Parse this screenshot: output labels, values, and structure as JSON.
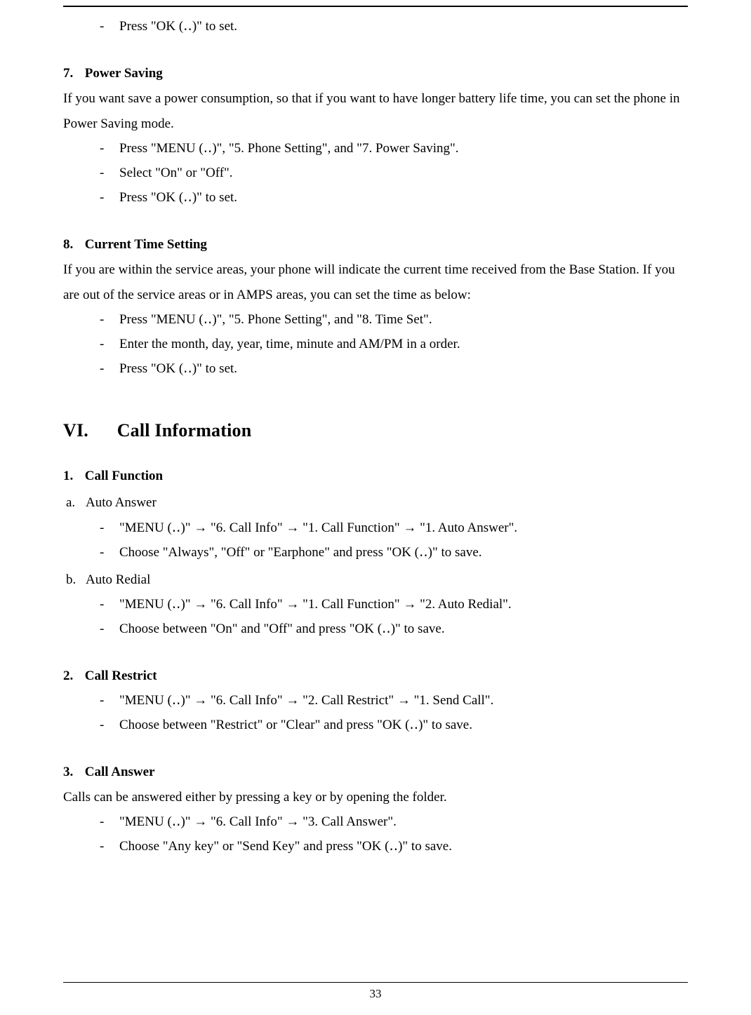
{
  "intro_bullet": "Press \"OK (‥)\" to set.",
  "sec7": {
    "heading_num": "7.",
    "heading_text": "Power Saving",
    "para": "If you want save a power consumption, so that if you want to have longer battery life time, you can set the phone in Power Saving mode.",
    "bullets": [
      "Press \"MENU (‥)\", \"5. Phone Setting\", and \"7. Power Saving\".",
      "Select \"On\" or \"Off\".",
      "Press \"OK (‥)\" to set."
    ]
  },
  "sec8": {
    "heading_num": "8.",
    "heading_text": "Current Time Setting",
    "para": "If you are within the service areas, your phone will indicate the current time received from the Base Station. If you are out of the service areas or in AMPS areas, you can set the time as below:",
    "bullets": [
      "Press \"MENU (‥)\", \"5. Phone Setting\", and \"8. Time Set\".",
      "Enter the month, day, year, time, minute and AM/PM in a order.",
      "Press \"OK (‥)\" to set."
    ]
  },
  "chapter": {
    "roman": "VI.",
    "title": "Call Information"
  },
  "sec1": {
    "heading_num": "1.",
    "heading_text": "Call Function",
    "a_label": "a.",
    "a_text": "Auto Answer",
    "a_bullets": [
      "\"MENU (‥)\" → \"6. Call Info\" → \"1. Call Function\" → \"1. Auto Answer\".",
      "Choose \"Always\", \"Off\" or \"Earphone\" and press \"OK (‥)\" to save."
    ],
    "b_label": "b.",
    "b_text": "Auto Redial",
    "b_bullets": [
      "\"MENU (‥)\" → \"6. Call Info\" → \"1. Call Function\" → \"2. Auto Redial\".",
      "Choose between \"On\" and \"Off\" and press \"OK (‥)\" to save."
    ]
  },
  "sec2": {
    "heading_num": "2.",
    "heading_text": "Call Restrict",
    "bullets": [
      "\"MENU (‥)\" → \"6. Call Info\" → \"2. Call Restrict\" → \"1. Send Call\".",
      "Choose between \"Restrict\" or \"Clear\" and press \"OK (‥)\" to save."
    ]
  },
  "sec3": {
    "heading_num": "3.",
    "heading_text": "Call Answer",
    "para": "Calls can be answered either by pressing a key or by opening the folder.",
    "bullets": [
      "\"MENU (‥)\" → \"6. Call Info\" → \"3. Call Answer\".",
      "Choose \"Any key\" or \"Send Key\" and press \"OK (‥)\" to save."
    ]
  },
  "page_number": "33"
}
